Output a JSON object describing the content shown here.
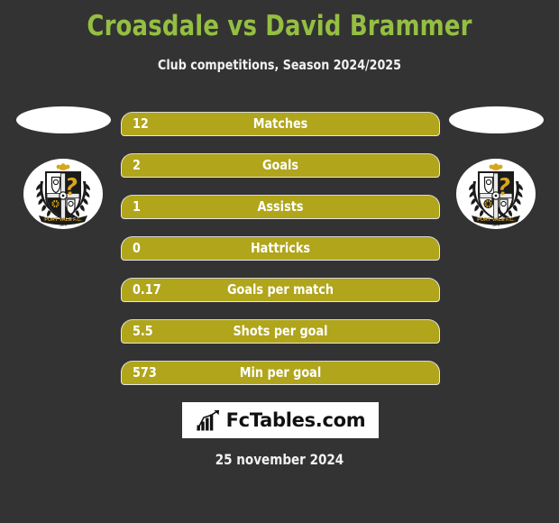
{
  "colors": {
    "background": "#333333",
    "title_green": "#94bf42",
    "bar_gold": "#b0a51b",
    "bar_border": "#e8e8e8",
    "text_white": "#ffffff",
    "brand_box": "#ffffff",
    "brand_text": "#111111"
  },
  "header": {
    "title": "Croasdale vs David Brammer",
    "subtitle": "Club competitions, Season 2024/2025"
  },
  "left_player": {
    "photo_placeholder": "player-photo-placeholder",
    "club_crest_name": "port-vale-fc-crest",
    "club_crest_text": "PORT VALE F.C."
  },
  "right_player": {
    "photo_placeholder": "player-photo-placeholder",
    "club_crest_name": "port-vale-fc-crest",
    "club_crest_text": "PORT VALE F.C."
  },
  "stats": [
    {
      "label": "Matches",
      "value": "12"
    },
    {
      "label": "Goals",
      "value": "2"
    },
    {
      "label": "Assists",
      "value": "1"
    },
    {
      "label": "Hattricks",
      "value": "0"
    },
    {
      "label": "Goals per match",
      "value": "0.17"
    },
    {
      "label": "Shots per goal",
      "value": "5.5"
    },
    {
      "label": "Min per goal",
      "value": "573"
    }
  ],
  "footer": {
    "brand_name": "FcTables.com",
    "brand_icon": "bar-chart-growth-icon",
    "date": "25 november 2024"
  },
  "chart_data": {
    "type": "table",
    "title": "Croasdale vs David Brammer",
    "subtitle": "Club competitions, Season 2024/2025",
    "categories": [
      "Matches",
      "Goals",
      "Assists",
      "Hattricks",
      "Goals per match",
      "Shots per goal",
      "Min per goal"
    ],
    "values": [
      12,
      2,
      1,
      0,
      0.17,
      5.5,
      573
    ],
    "value_labels": [
      "12",
      "2",
      "1",
      "0",
      "0.17",
      "5.5",
      "573"
    ],
    "xlabel": "",
    "ylabel": "",
    "legend": [],
    "grid": false
  }
}
